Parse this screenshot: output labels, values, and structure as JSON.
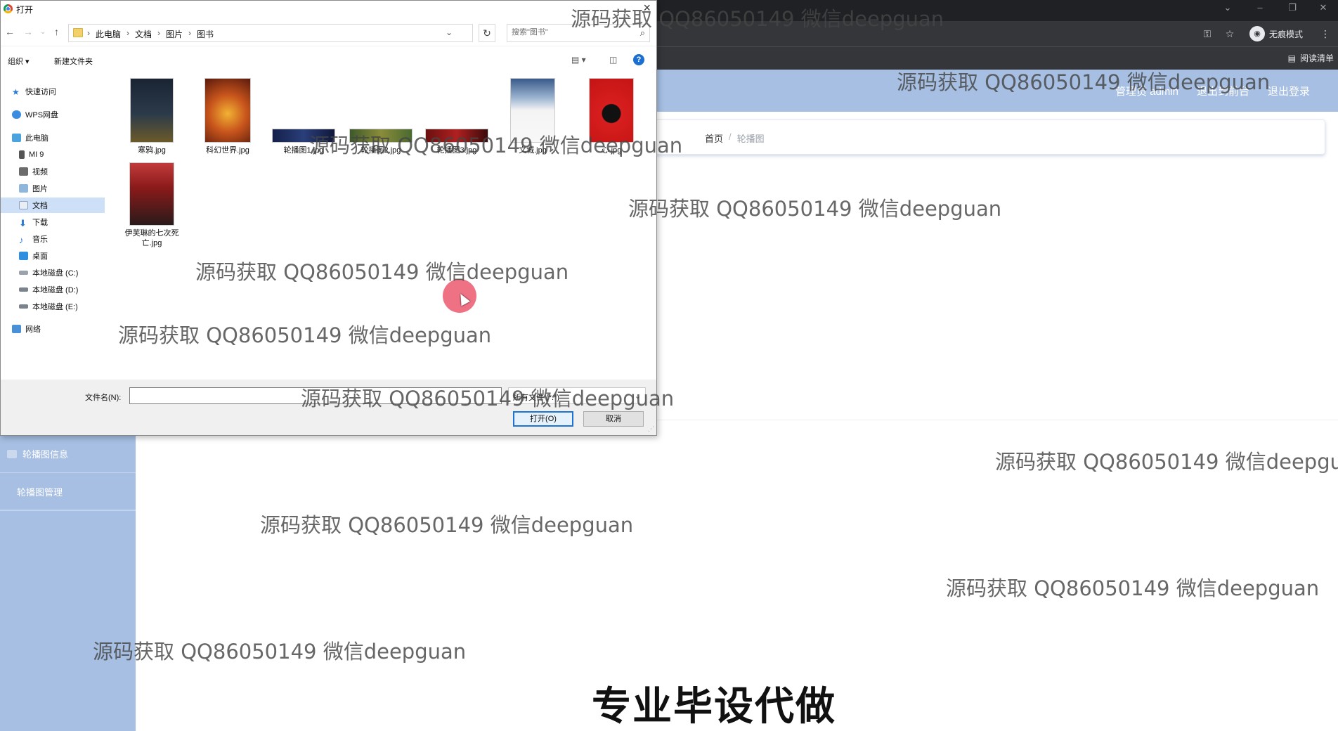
{
  "browser": {
    "incognito_label": "无痕模式",
    "reading_list_label": "阅读清单"
  },
  "app": {
    "header_links": [
      "管理员 admin",
      "退出到前台",
      "退出登录"
    ],
    "sidebar": {
      "group_label": "轮播图信息",
      "sub_label": "轮播图管理"
    },
    "breadcrumb": {
      "home": "首页",
      "sep": "/",
      "current": "轮播图"
    }
  },
  "dialog": {
    "title": "打开",
    "address_crumbs": [
      "此电脑",
      "文档",
      "图片",
      "图书"
    ],
    "search_placeholder": "搜索\"图书\"",
    "organize_label": "组织 ▾",
    "new_folder_label": "新建文件夹",
    "help_label": "?",
    "nav_items": {
      "quick_access": "快速访问",
      "wps": "WPS网盘",
      "this_pc": "此电脑",
      "mi9": "MI 9",
      "videos": "视频",
      "pictures": "图片",
      "documents": "文档",
      "downloads": "下载",
      "music": "音乐",
      "desktop": "桌面",
      "disk_c": "本地磁盘 (C:)",
      "disk_d": "本地磁盘 (D:)",
      "disk_e": "本地磁盘 (E:)",
      "network": "网络"
    },
    "files": [
      "寒鸦.jpg",
      "科幻世界.jpg",
      "轮播图1.jpg",
      "轮播图2.jpg",
      "轮播图3.jpg",
      "文城.jpg",
      "心.jpg",
      "伊芙琳的七次死亡.jpg"
    ],
    "filename_label": "文件名(N):",
    "filename_value": "",
    "filetype_label": "所有文件 (*.*)",
    "open_button": "打开(O)",
    "cancel_button": "取消"
  },
  "overlay": {
    "watermark": "源码获取 QQ86050149 微信deepguan",
    "banner": "专业毕设代做"
  }
}
